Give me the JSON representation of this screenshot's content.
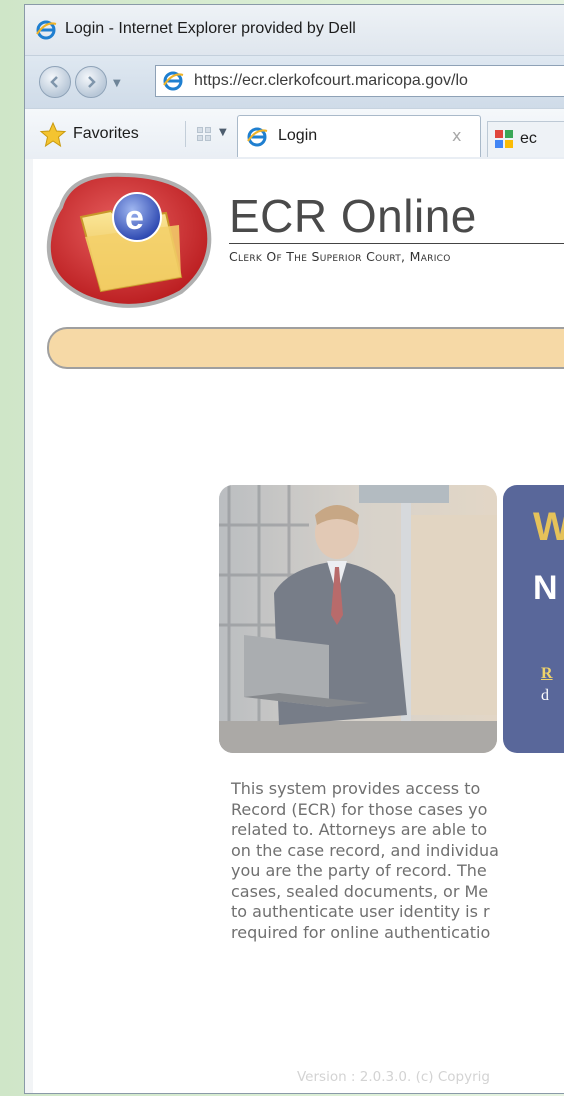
{
  "window": {
    "title": "Login - Internet Explorer provided by Dell"
  },
  "navbar": {
    "url": "https://ecr.clerkofcourt.maricopa.gov/lo"
  },
  "favorites_bar": {
    "favorites_label": "Favorites",
    "tabs": [
      {
        "label": "Login",
        "close": "x",
        "icon": "ie-icon"
      },
      {
        "label": "ec",
        "icon": "site-favicon"
      }
    ]
  },
  "page": {
    "brand_title": "ECR Online",
    "brand_subtitle": "Clerk Of The Superior Court, Marico",
    "welcome": {
      "heading_letter": "W",
      "subheading_letter": "N",
      "link_fragment": "R",
      "text_fragment": "d"
    },
    "body_lines": [
      "This system provides access to",
      "Record (ECR) for those cases yo",
      "related to. Attorneys are able to",
      "on the case record, and individua",
      "you are the party of record. The",
      "cases, sealed documents, or Me",
      "to authenticate user identity is r",
      "required for online authenticatio"
    ],
    "version": "Version : 2.0.3.0. (c) Copyrig"
  },
  "colors": {
    "nav_pill": "#f6d9a6",
    "welcome_panel": "#59679a",
    "welcome_accent": "#e5c25a"
  }
}
